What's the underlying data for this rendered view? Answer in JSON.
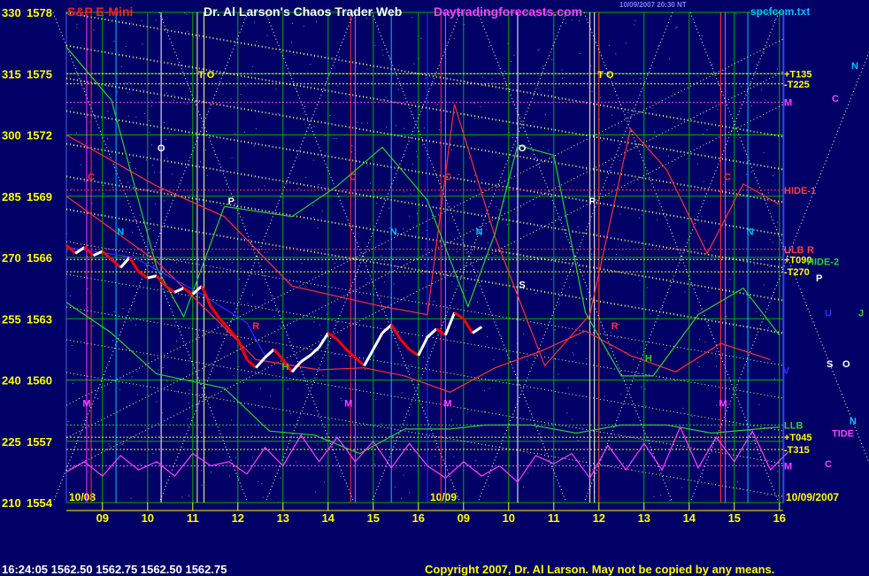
{
  "header": {
    "symbol": "S&P E-Mini",
    "title": "Dr. Al Larson's Chaos Trader Web",
    "site": "Daytradingforecasts.com",
    "timestamp": "10/09/2007 20:30 NT",
    "file": "spcfcom.txt"
  },
  "footer": {
    "quote": "16:24:05  1562.50  1562.75  1562.50  1562.75",
    "copyright": "Copyright 2007, Dr. Al Larson. May not be copied by any means."
  },
  "colors": {
    "background": "#000066",
    "price_up": "#ffffff",
    "price_down": "#ff0000",
    "grid": "#00c000",
    "flux_lines": "#ffff80",
    "cycle_red": "#ff3030",
    "cycle_green": "#30d030",
    "cycle_magenta": "#ff40ff",
    "cycle_blue": "#3030ff"
  },
  "chart_data": {
    "type": "line",
    "title": "S&P E-Mini",
    "ylim": [
      1554,
      1578
    ],
    "y_left_ticks": [
      "210",
      "225",
      "240",
      "255",
      "270",
      "285",
      "300",
      "315",
      "330"
    ],
    "y_right_ticks": [
      "1554",
      "1557",
      "1560",
      "1563",
      "1566",
      "1569",
      "1572",
      "1575",
      "1578"
    ],
    "x_ticks": [
      "09",
      "10",
      "11",
      "12",
      "13",
      "14",
      "15",
      "16",
      "09",
      "10",
      "11",
      "12",
      "13",
      "14",
      "15",
      "16"
    ],
    "x_range_hours": [
      8.2,
      16.2
    ],
    "session_labels": [
      "10/08",
      "10/09",
      "10/09/2007"
    ],
    "price_series": {
      "name": "price",
      "points": [
        [
          0,
          1566.6
        ],
        [
          0.2,
          1566.2
        ],
        [
          0.4,
          1566.5
        ],
        [
          0.6,
          1566.1
        ],
        [
          0.8,
          1566.3
        ],
        [
          1.0,
          1565.9
        ],
        [
          1.2,
          1565.5
        ],
        [
          1.4,
          1566.0
        ],
        [
          1.6,
          1565.3
        ],
        [
          1.8,
          1565.0
        ],
        [
          2.0,
          1565.1
        ],
        [
          2.2,
          1564.6
        ],
        [
          2.4,
          1564.3
        ],
        [
          2.6,
          1564.5
        ],
        [
          2.8,
          1564.2
        ],
        [
          3.0,
          1564.6
        ],
        [
          3.2,
          1563.6
        ],
        [
          3.4,
          1563.0
        ],
        [
          3.6,
          1562.5
        ],
        [
          3.8,
          1562.0
        ],
        [
          4.0,
          1561.0
        ],
        [
          4.2,
          1560.6
        ],
        [
          4.4,
          1561.1
        ],
        [
          4.6,
          1561.5
        ],
        [
          4.8,
          1561.0
        ],
        [
          5.0,
          1560.4
        ],
        [
          5.2,
          1560.9
        ],
        [
          5.4,
          1561.2
        ],
        [
          5.6,
          1561.6
        ],
        [
          5.8,
          1562.3
        ],
        [
          6.0,
          1562.0
        ],
        [
          6.2,
          1561.5
        ],
        [
          6.4,
          1561.1
        ],
        [
          6.6,
          1560.7
        ],
        [
          6.8,
          1561.5
        ],
        [
          7.0,
          1562.3
        ],
        [
          7.2,
          1562.7
        ],
        [
          7.4,
          1562.0
        ],
        [
          7.6,
          1561.5
        ],
        [
          7.8,
          1561.2
        ],
        [
          8.0,
          1562.1
        ],
        [
          8.2,
          1562.5
        ],
        [
          8.4,
          1562.2
        ],
        [
          8.6,
          1563.3
        ],
        [
          8.8,
          1563.0
        ],
        [
          9.0,
          1562.3
        ],
        [
          9.2,
          1562.6
        ]
      ]
    },
    "series": [
      {
        "name": "C",
        "color": "#ff3030",
        "points": [
          [
            0,
            1572.0
          ],
          [
            2,
            1569.5
          ],
          [
            3.5,
            1568.0
          ],
          [
            5,
            1564.6
          ],
          [
            7,
            1563.6
          ],
          [
            8,
            1563.2
          ],
          [
            8.6,
            1573.5
          ],
          [
            9.5,
            1567.0
          ],
          [
            10.6,
            1560.7
          ],
          [
            11.6,
            1563.2
          ],
          [
            12.5,
            1572.3
          ],
          [
            13.3,
            1570.3
          ],
          [
            14.2,
            1566.2
          ],
          [
            15,
            1569.6
          ],
          [
            15.8,
            1568.6
          ]
        ]
      },
      {
        "name": "C2",
        "color": "#ff3030",
        "points": [
          [
            0,
            1569.0
          ],
          [
            2,
            1565.8
          ],
          [
            3.4,
            1562.8
          ],
          [
            4.2,
            1561.0
          ],
          [
            5.6,
            1560.5
          ],
          [
            6.6,
            1560.6
          ],
          [
            7.5,
            1560.2
          ],
          [
            8.5,
            1559.4
          ],
          [
            9.5,
            1560.6
          ],
          [
            10.5,
            1561.4
          ],
          [
            11.5,
            1562.4
          ],
          [
            12.5,
            1561.2
          ],
          [
            13.5,
            1560.4
          ],
          [
            14.5,
            1561.8
          ],
          [
            15.6,
            1561.0
          ]
        ]
      },
      {
        "name": "H",
        "color": "#30d030",
        "points": [
          [
            0,
            1576.3
          ],
          [
            1,
            1573.7
          ],
          [
            2,
            1565.5
          ],
          [
            2.6,
            1563.1
          ],
          [
            3.5,
            1568.5
          ],
          [
            5,
            1568.0
          ],
          [
            6,
            1569.5
          ],
          [
            7,
            1571.4
          ],
          [
            8,
            1568.8
          ],
          [
            8.9,
            1563.6
          ],
          [
            9.5,
            1567.2
          ],
          [
            10,
            1571.5
          ],
          [
            10.8,
            1571.0
          ],
          [
            11.5,
            1563.3
          ],
          [
            12.3,
            1560.2
          ],
          [
            13,
            1560.2
          ],
          [
            14,
            1563.2
          ],
          [
            15,
            1564.5
          ],
          [
            15.8,
            1562.2
          ]
        ]
      },
      {
        "name": "H2",
        "color": "#30d030",
        "points": [
          [
            0,
            1563.8
          ],
          [
            1,
            1562.3
          ],
          [
            2,
            1560.3
          ],
          [
            3.5,
            1559.6
          ],
          [
            4.5,
            1557.5
          ],
          [
            5.5,
            1557.3
          ],
          [
            6.5,
            1556.4
          ],
          [
            7.5,
            1557.6
          ],
          [
            8.5,
            1557.6
          ],
          [
            9.3,
            1557.8
          ],
          [
            10.3,
            1557.8
          ],
          [
            11.3,
            1557.4
          ],
          [
            12.3,
            1557.8
          ],
          [
            13.3,
            1557.8
          ],
          [
            14.3,
            1557.4
          ],
          [
            15.8,
            1557.7
          ]
        ]
      },
      {
        "name": "blue",
        "color": "#3030ff",
        "points": [
          [
            0,
            1566.5
          ],
          [
            1.5,
            1566.0
          ],
          [
            3,
            1564.2
          ],
          [
            4,
            1562.8
          ],
          [
            4.4,
            1561.2
          ]
        ]
      },
      {
        "name": "M",
        "color": "#ff40ff",
        "points": [
          [
            0,
            1555.5
          ],
          [
            0.4,
            1556.0
          ],
          [
            0.8,
            1555.3
          ],
          [
            1.2,
            1556.3
          ],
          [
            1.6,
            1555.6
          ],
          [
            2.0,
            1556.0
          ],
          [
            2.4,
            1555.3
          ],
          [
            2.8,
            1556.4
          ],
          [
            3.2,
            1555.8
          ],
          [
            3.6,
            1556.0
          ],
          [
            4.0,
            1555.4
          ],
          [
            4.4,
            1556.7
          ],
          [
            4.8,
            1555.8
          ],
          [
            5.2,
            1557.3
          ],
          [
            5.6,
            1556.0
          ],
          [
            6.0,
            1557.2
          ],
          [
            6.4,
            1556.0
          ],
          [
            6.8,
            1557.0
          ],
          [
            7.2,
            1555.7
          ],
          [
            7.6,
            1556.9
          ],
          [
            8.0,
            1555.8
          ],
          [
            8.4,
            1555.2
          ],
          [
            8.8,
            1556.0
          ],
          [
            9.2,
            1555.3
          ],
          [
            9.6,
            1555.8
          ],
          [
            10.0,
            1555.0
          ],
          [
            10.4,
            1556.3
          ],
          [
            10.8,
            1555.9
          ],
          [
            11.2,
            1556.4
          ],
          [
            11.6,
            1555.2
          ],
          [
            12.0,
            1556.8
          ],
          [
            12.4,
            1555.6
          ],
          [
            12.8,
            1556.9
          ],
          [
            13.2,
            1555.6
          ],
          [
            13.6,
            1557.7
          ],
          [
            14.0,
            1555.7
          ],
          [
            14.4,
            1557.2
          ],
          [
            14.8,
            1556.0
          ],
          [
            15.2,
            1557.5
          ],
          [
            15.6,
            1555.6
          ],
          [
            16.0,
            1556.5
          ]
        ]
      }
    ],
    "levels": [
      {
        "label": "+T135",
        "value": 1575.0,
        "color": "#ffff00"
      },
      {
        "label": "-T225",
        "value": 1574.5,
        "color": "#ffff00"
      },
      {
        "label": "M",
        "value": 1573.6,
        "color": "#ff40ff"
      },
      {
        "label": "HIDE-1",
        "value": 1569.3,
        "color": "#ff4040"
      },
      {
        "label": "ULB",
        "value": 1566.4,
        "color": "#ff4040"
      },
      {
        "label": "+T090",
        "value": 1565.9,
        "color": "#ffff00"
      },
      {
        "label": "-T270",
        "value": 1565.3,
        "color": "#ffff00"
      },
      {
        "label": "LLB",
        "value": 1557.8,
        "color": "#30d030"
      },
      {
        "label": "+T045",
        "value": 1557.2,
        "color": "#ffff00"
      },
      {
        "label": "-T315",
        "value": 1556.6,
        "color": "#ffff00"
      },
      {
        "label": "M",
        "value": 1555.8,
        "color": "#ff40ff"
      }
    ],
    "edge_labels": [
      {
        "text": "HIDE-2",
        "value": 1565.8,
        "color": "#30d030"
      },
      {
        "text": "R",
        "value": 1566.4,
        "color": "#ff4040"
      },
      {
        "text": "TIDE",
        "value": 1557.4,
        "color": "#ff40ff"
      },
      {
        "text": "N",
        "value": 1575.4,
        "color": "#00c0ff"
      },
      {
        "text": "C",
        "value": 1573.8,
        "color": "#ff40ff"
      },
      {
        "text": "P",
        "value": 1565.0,
        "color": "#ffffff"
      },
      {
        "text": "J",
        "value": 1563.3,
        "color": "#30d030"
      },
      {
        "text": "U",
        "value": 1563.3,
        "color": "#3030ff"
      },
      {
        "text": "O",
        "value": 1560.8,
        "color": "#ffffff"
      },
      {
        "text": "S",
        "value": 1560.8,
        "color": "#ffffff"
      },
      {
        "text": "N",
        "value": 1558.0,
        "color": "#00c0ff"
      },
      {
        "text": "C",
        "value": 1555.9,
        "color": "#ff40ff"
      }
    ],
    "markers": [
      {
        "text": "C",
        "x": 0.55,
        "y": 1569.8,
        "color": "#ff3030"
      },
      {
        "text": "N",
        "x": 1.2,
        "y": 1567.1,
        "color": "#00c0ff"
      },
      {
        "text": "O",
        "x": 2.1,
        "y": 1571.2,
        "color": "#ffffff"
      },
      {
        "text": "T O",
        "x": 3.1,
        "y": 1574.8,
        "color": "#ffff00"
      },
      {
        "text": "P",
        "x": 3.65,
        "y": 1568.6,
        "color": "#ffffff"
      },
      {
        "text": "M",
        "x": 0.45,
        "y": 1558.7,
        "color": "#ff40ff"
      },
      {
        "text": "R",
        "x": 4.2,
        "y": 1562.5,
        "color": "#ff3030"
      },
      {
        "text": "H",
        "x": 4.85,
        "y": 1560.5,
        "color": "#30d030"
      },
      {
        "text": "C",
        "x": 6.35,
        "y": 1569.8,
        "color": "#ff3030"
      },
      {
        "text": "N",
        "x": 7.25,
        "y": 1567.1,
        "color": "#00c0ff"
      },
      {
        "text": "M",
        "x": 6.25,
        "y": 1558.7,
        "color": "#ff40ff"
      },
      {
        "text": "C",
        "x": 8.45,
        "y": 1569.8,
        "color": "#ff3030"
      },
      {
        "text": "N",
        "x": 9.15,
        "y": 1567.1,
        "color": "#00c0ff"
      },
      {
        "text": "O",
        "x": 10.1,
        "y": 1571.2,
        "color": "#ffffff"
      },
      {
        "text": "S",
        "x": 10.1,
        "y": 1564.5,
        "color": "#ffffff"
      },
      {
        "text": "T O",
        "x": 11.95,
        "y": 1574.8,
        "color": "#ffff00"
      },
      {
        "text": "P",
        "x": 11.65,
        "y": 1568.6,
        "color": "#ffffff"
      },
      {
        "text": "M",
        "x": 8.45,
        "y": 1558.7,
        "color": "#ff40ff"
      },
      {
        "text": "R",
        "x": 12.15,
        "y": 1562.5,
        "color": "#ff3030"
      },
      {
        "text": "H",
        "x": 12.9,
        "y": 1560.9,
        "color": "#30d030"
      },
      {
        "text": "C",
        "x": 14.65,
        "y": 1569.8,
        "color": "#ff3030"
      },
      {
        "text": "N",
        "x": 15.15,
        "y": 1567.1,
        "color": "#00c0ff"
      },
      {
        "text": "M",
        "x": 14.55,
        "y": 1558.7,
        "color": "#ff40ff"
      },
      {
        "text": "V",
        "x": 15.95,
        "y": 1560.3,
        "color": "#3030ff"
      }
    ],
    "grid": true
  }
}
